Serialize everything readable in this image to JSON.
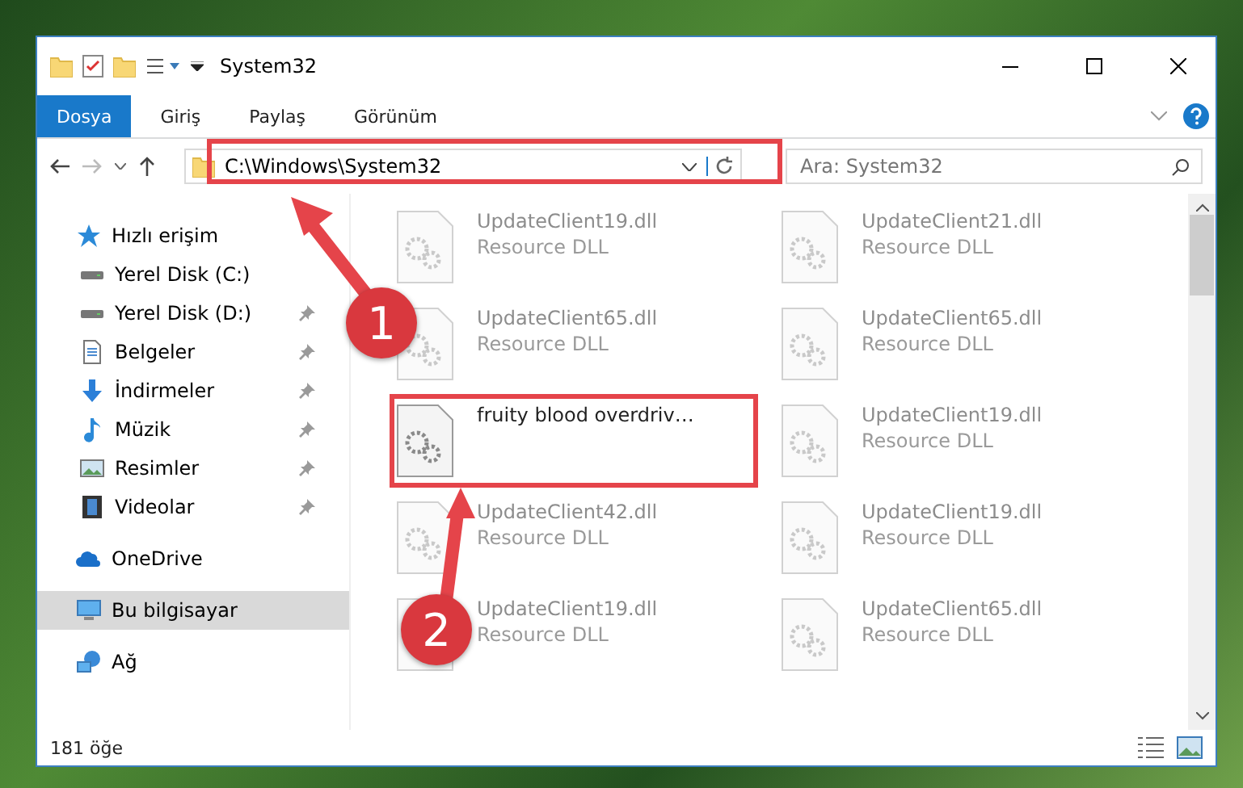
{
  "window": {
    "title": "System32"
  },
  "ribbon_tabs": [
    {
      "label": "Dosya",
      "selected": true
    },
    {
      "label": "Giriş",
      "selected": false
    },
    {
      "label": "Paylaş",
      "selected": false
    },
    {
      "label": "Görünüm",
      "selected": false
    }
  ],
  "address": {
    "path": "C:\\Windows\\System32"
  },
  "search": {
    "placeholder": "Ara: System32"
  },
  "nav": [
    {
      "label": "Hızlı erişim",
      "kind": "star",
      "pinned": false,
      "selected": false,
      "children": [
        {
          "label": "Yerel Disk (C:)",
          "kind": "disk",
          "pinned": false,
          "selected": false
        },
        {
          "label": "Yerel Disk (D:)",
          "kind": "disk",
          "pinned": true,
          "selected": false
        },
        {
          "label": "Belgeler",
          "kind": "doc",
          "pinned": true,
          "selected": false
        },
        {
          "label": "İndirmeler",
          "kind": "download",
          "pinned": true,
          "selected": false
        },
        {
          "label": "Müzik",
          "kind": "music",
          "pinned": true,
          "selected": false
        },
        {
          "label": "Resimler",
          "kind": "pictures",
          "pinned": true,
          "selected": false
        },
        {
          "label": "Videolar",
          "kind": "video",
          "pinned": true,
          "selected": false
        }
      ]
    },
    {
      "label": "OneDrive",
      "kind": "cloud",
      "pinned": false,
      "selected": false
    },
    {
      "label": "Bu bilgisayar",
      "kind": "pc",
      "pinned": false,
      "selected": true
    },
    {
      "label": "Ağ",
      "kind": "network",
      "pinned": false,
      "selected": false
    }
  ],
  "files": [
    {
      "name": "UpdateClient19.dll",
      "type": "Resource DLL",
      "blurred": true
    },
    {
      "name": "UpdateClient21.dll",
      "type": "Resource DLL",
      "blurred": true
    },
    {
      "name": "UpdateClient65.dll",
      "type": "Resource DLL",
      "blurred": true
    },
    {
      "name": "UpdateClient65.dll",
      "type": "Resource DLL",
      "blurred": true
    },
    {
      "name": "fruity blood overdriv…",
      "blurred": false,
      "highlighted": true
    },
    {
      "name": "UpdateClient19.dll",
      "type": "Resource DLL",
      "blurred": true
    },
    {
      "name": "UpdateClient42.dll",
      "type": "Resource DLL",
      "blurred": true
    },
    {
      "name": "UpdateClient19.dll",
      "type": "Resource DLL",
      "blurred": true
    },
    {
      "name": "UpdateClient19.dll",
      "type": "Resource DLL",
      "blurred": true
    },
    {
      "name": "UpdateClient65.dll",
      "type": "Resource DLL",
      "blurred": true
    }
  ],
  "status_bar": {
    "count": "181 öğe"
  },
  "callouts": [
    {
      "label": "1"
    },
    {
      "label": "2"
    }
  ]
}
